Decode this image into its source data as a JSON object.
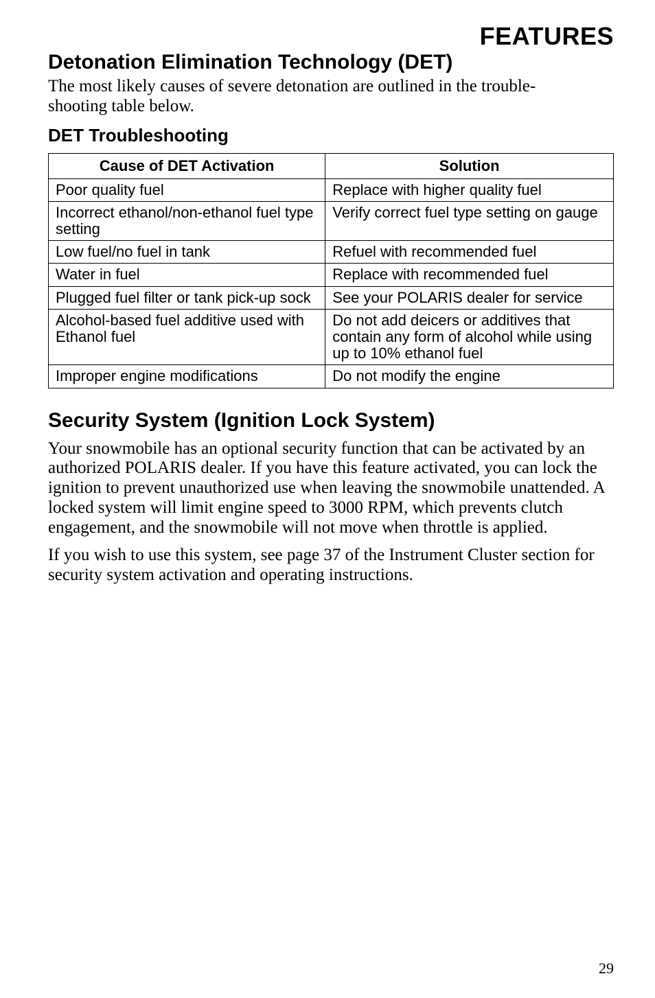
{
  "header": {
    "features": "FEATURES",
    "title1": "Detonation Elimination Technology (DET)",
    "intro1a": "The most likely causes of severe detonation are outlined in the trouble-",
    "intro1b": "shooting table below.",
    "subheading1": "DET Troubleshooting"
  },
  "table": {
    "th1": "Cause of DET Activation",
    "th2": "Solution",
    "rows": [
      {
        "c1": "Poor quality fuel",
        "c2": "Replace with higher quality fuel"
      },
      {
        "c1": "Incorrect ethanol/non-ethanol fuel type setting",
        "c2": "Verify correct fuel type setting on gauge"
      },
      {
        "c1": "Low fuel/no fuel in tank",
        "c2": "Refuel with recommended fuel"
      },
      {
        "c1": "Water in fuel",
        "c2": "Replace with recommended fuel"
      },
      {
        "c1": "Plugged fuel filter or tank pick-up sock",
        "c2": "See your POLARIS dealer for service"
      },
      {
        "c1": "Alcohol-based fuel additive used with Ethanol fuel",
        "c2": "Do not add deicers or additives that contain any form of alcohol while using up to 10% ethanol fuel"
      },
      {
        "c1": "Improper engine modifications",
        "c2": "Do not modify the engine"
      }
    ]
  },
  "section2": {
    "title": "Security System (Ignition Lock System)",
    "p1": "Your snowmobile has an optional security function that can be activated by an authorized POLARIS dealer. If you have this feature activated, you can lock the ignition to prevent unauthorized use when leaving the snowmobile unattended. A locked system will limit engine speed to 3000 RPM, which prevents clutch engagement, and the snowmobile will not move when throttle is applied.",
    "p2": "If you wish to use this system, see page 37 of the Instrument Cluster section for security system activation and operating instructions."
  },
  "pagenum": "29"
}
